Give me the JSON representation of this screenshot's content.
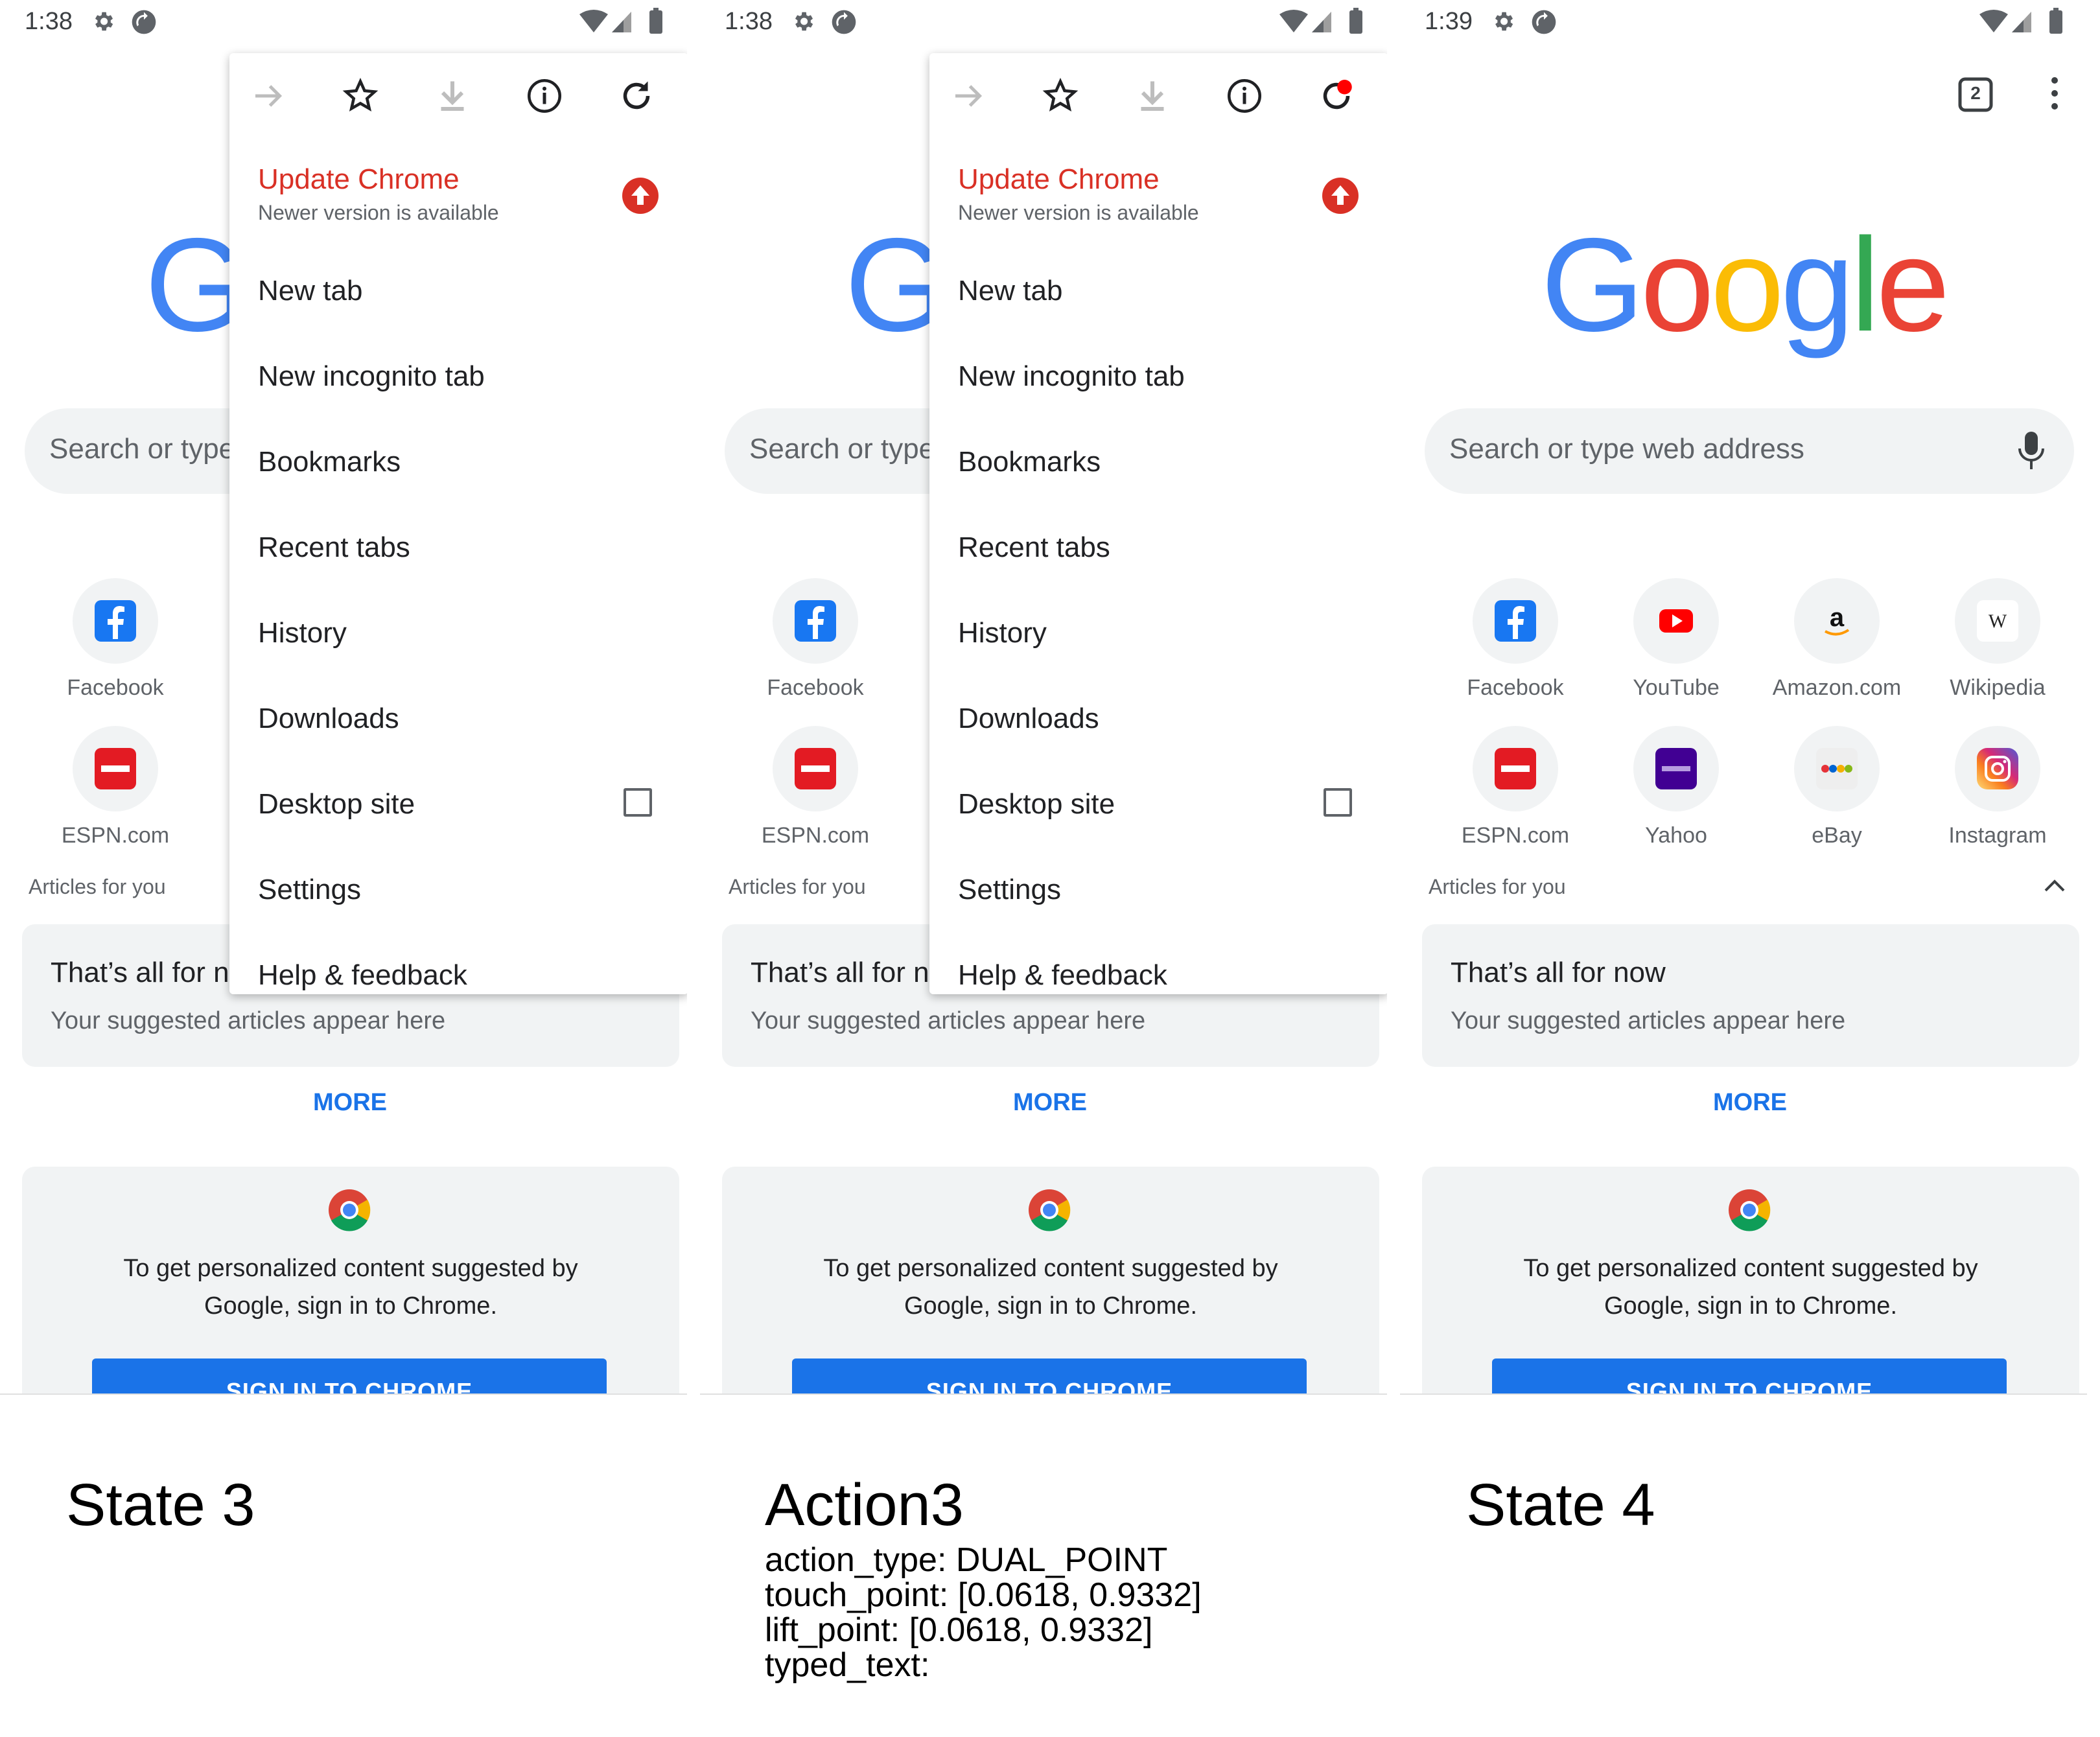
{
  "screens": [
    {
      "status_time": "1:38",
      "search_placeholder": "Search or type",
      "tiles": [
        {
          "label": "Facebook"
        },
        {
          "label": "ESPN.com"
        }
      ],
      "articles_header": "Articles for you",
      "card_title": "That’s all for n",
      "card_subtitle": "Your suggested articles appear here",
      "more": "MORE",
      "signin_line1": "To get personalized content suggested by",
      "signin_line2": "Google, sign in to Chrome.",
      "signin_button": "SIGN IN TO CHROME",
      "menu": {
        "update_title": "Update Chrome",
        "update_subtitle": "Newer version is available",
        "items": [
          "New tab",
          "New incognito tab",
          "Bookmarks",
          "Recent tabs",
          "History",
          "Downloads",
          "Desktop site",
          "Settings",
          "Help & feedback"
        ]
      }
    },
    {
      "status_time": "1:38",
      "search_placeholder": "Search or type",
      "tiles": [
        {
          "label": "Facebook"
        },
        {
          "label": "ESPN.com"
        }
      ],
      "articles_header": "Articles for you",
      "card_title": "That’s all for n",
      "card_subtitle": "Your suggested articles appear here",
      "more": "MORE",
      "signin_line1": "To get personalized content suggested by",
      "signin_line2": "Google, sign in to Chrome.",
      "signin_button": "SIGN IN TO CHROME",
      "menu": {
        "update_title": "Update Chrome",
        "update_subtitle": "Newer version is available",
        "items": [
          "New tab",
          "New incognito tab",
          "Bookmarks",
          "Recent tabs",
          "History",
          "Downloads",
          "Desktop site",
          "Settings",
          "Help & feedback"
        ]
      }
    },
    {
      "status_time": "1:39",
      "tab_count": "2",
      "logo_letters": [
        "G",
        "o",
        "o",
        "g",
        "l",
        "e"
      ],
      "search_placeholder": "Search or type web address",
      "tiles": [
        {
          "label": "Facebook"
        },
        {
          "label": "YouTube"
        },
        {
          "label": "Amazon.com"
        },
        {
          "label": "Wikipedia"
        },
        {
          "label": "ESPN.com"
        },
        {
          "label": "Yahoo"
        },
        {
          "label": "eBay"
        },
        {
          "label": "Instagram"
        }
      ],
      "articles_header": "Articles for you",
      "card_title": "That’s all for now",
      "card_subtitle": "Your suggested articles appear here",
      "more": "MORE",
      "signin_line1": "To get personalized content suggested by",
      "signin_line2": "Google, sign in to Chrome.",
      "signin_button": "SIGN IN TO CHROME"
    }
  ],
  "captions": {
    "state3": "State 3",
    "action3": "Action3",
    "state4": "State 4"
  },
  "action": {
    "action_type": "action_type: DUAL_POINT",
    "touch_point": "touch_point: [0.0618, 0.9332]",
    "lift_point": "lift_point: [0.0618, 0.9332]",
    "typed_text": "typed_text:"
  },
  "colors": {
    "accent_blue": "#1a73e8",
    "update_red": "#d93025",
    "card_gray": "#f1f3f4"
  }
}
